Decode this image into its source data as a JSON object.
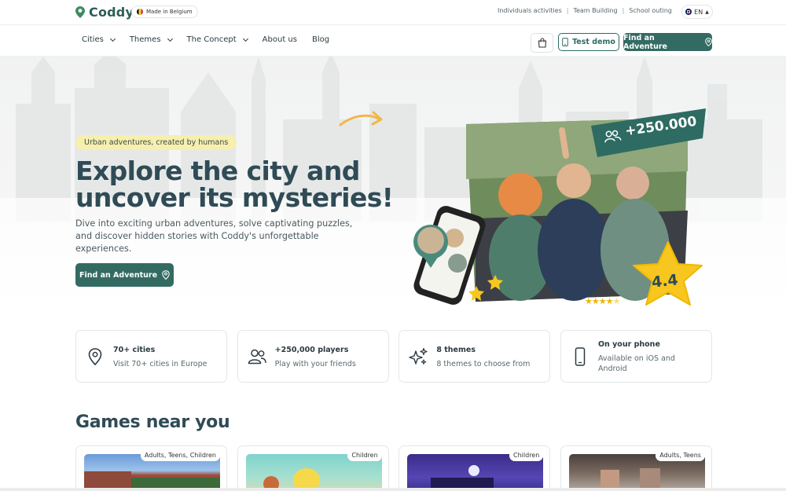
{
  "brand": {
    "name": "Coddy",
    "made_in": "Made in Belgium",
    "accent": "#336b63",
    "heading_color": "#2f4b56",
    "tag_bg": "#f7efad"
  },
  "toplinks": [
    "Individuals activities",
    "Team Building",
    "School outing"
  ],
  "language": "EN",
  "nav": {
    "items": [
      {
        "label": "Cities",
        "dropdown": true
      },
      {
        "label": "Themes",
        "dropdown": true
      },
      {
        "label": "The Concept",
        "dropdown": true
      },
      {
        "label": "About us",
        "dropdown": false
      },
      {
        "label": "Blog",
        "dropdown": false
      }
    ],
    "test_demo": "Test demo",
    "find_adventure": "Find an Adventure"
  },
  "hero": {
    "tagline": "Urban adventures, created by humans",
    "title_line1": "Explore the city and",
    "title_line2": "uncover its mysteries!",
    "subtitle": "Dive into exciting urban adventures, solve captivating puzzles, and discover hidden stories with Coddy's unforgettable experiences.",
    "cta": "Find an Adventure",
    "players_badge": "+250.000",
    "rating": "4.4",
    "stars": 4.5
  },
  "features": [
    {
      "icon": "location-pin-icon",
      "title": "70+ cities",
      "desc": "Visit 70+ cities in Europe"
    },
    {
      "icon": "users-icon",
      "title": "+250,000 players",
      "desc": "Play with your friends"
    },
    {
      "icon": "sparkles-icon",
      "title": "8 themes",
      "desc": "8 themes to choose from"
    },
    {
      "icon": "phone-icon",
      "title": "On your phone",
      "desc": "Available on iOS and Android"
    }
  ],
  "games": {
    "title": "Games near you",
    "cards": [
      {
        "tag": "Adults, Teens, Children"
      },
      {
        "tag": "Children"
      },
      {
        "tag": "Children"
      },
      {
        "tag": "Adults, Teens"
      }
    ]
  }
}
